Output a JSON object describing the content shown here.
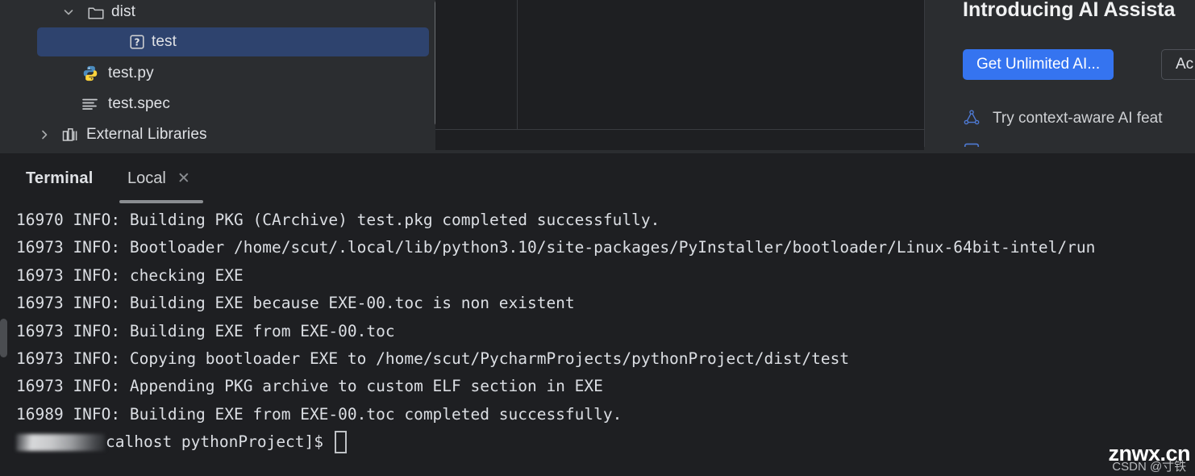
{
  "project_tree": {
    "rows": [
      {
        "label": "dist",
        "icon": "folder-icon",
        "chevron": "chevron-down-icon",
        "selected": false
      },
      {
        "label": "test",
        "icon": "unknown-file-icon",
        "chevron": "",
        "selected": true
      },
      {
        "label": "test.py",
        "icon": "python-file-icon",
        "chevron": "",
        "selected": false
      },
      {
        "label": "test.spec",
        "icon": "text-file-icon",
        "chevron": "",
        "selected": false
      },
      {
        "label": "External Libraries",
        "icon": "library-icon",
        "chevron": "chevron-right-icon",
        "selected": false
      }
    ],
    "selection_color": "#2e436e"
  },
  "ai_panel": {
    "title": "Introducing AI Assista",
    "primary_button": "Get Unlimited AI...",
    "secondary_button": "Ac",
    "features": [
      {
        "label": "Try context-aware AI feat",
        "icon": "ai-nodes-icon"
      },
      {
        "label": "",
        "icon": "ai-chat-icon"
      }
    ],
    "accent_color": "#3574f0"
  },
  "terminal": {
    "heading": "Terminal",
    "tab_label": "Local",
    "close_icon": "close-icon",
    "lines": [
      "16970 INFO: Building PKG (CArchive) test.pkg completed successfully.",
      "16973 INFO: Bootloader /home/scut/.local/lib/python3.10/site-packages/PyInstaller/bootloader/Linux-64bit-intel/run",
      "16973 INFO: checking EXE",
      "16973 INFO: Building EXE because EXE-00.toc is non existent",
      "16973 INFO: Building EXE from EXE-00.toc",
      "16973 INFO: Copying bootloader EXE to /home/scut/PycharmProjects/pythonProject/dist/test",
      "16973 INFO: Appending PKG archive to custom ELF section in EXE",
      "16989 INFO: Building EXE from EXE-00.toc completed successfully."
    ],
    "prompt_text": "calhost pythonProject]$",
    "prompt_redacted": true,
    "cursor": "block-cursor"
  },
  "watermark": {
    "main": "znwx.cn",
    "sub": "CSDN @寸铁"
  }
}
